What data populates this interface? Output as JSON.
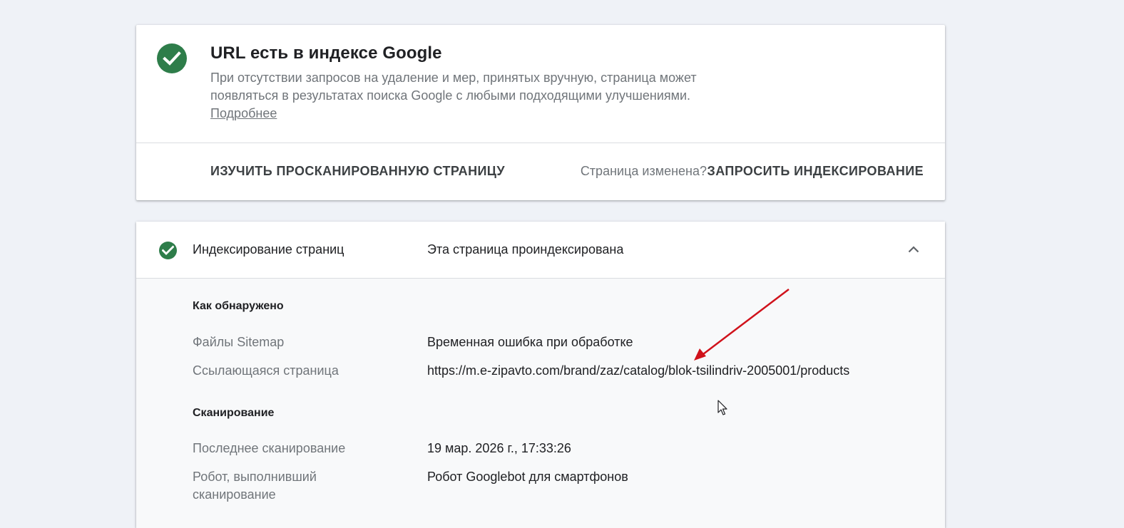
{
  "status": {
    "title": "URL есть в индексе Google",
    "description": "При отсутствии запросов на удаление и мер, принятых вручную, страница может появляться в результатах поиска Google с любыми подходящими улучшениями.",
    "learn_more": "Подробнее",
    "explore_button": "ИЗУЧИТЬ ПРОСКАНИРОВАННУЮ СТРАНИЦУ",
    "changed_question": "Страница изменена?",
    "request_button": "ЗАПРОСИТЬ ИНДЕКСИРОВАНИЕ"
  },
  "indexing": {
    "title": "Индексирование страниц",
    "status": "Эта страница проиндексирована",
    "discovery": {
      "heading": "Как обнаружено",
      "sitemaps_label": "Файлы Sitemap",
      "sitemaps_value": "Временная ошибка при обработке",
      "referring_label": "Ссылающаяся страница",
      "referring_value": "https://m.e-zipavto.com/brand/zaz/catalog/blok-tsilindriv-2005001/products"
    },
    "crawl": {
      "heading": "Сканирование",
      "last_crawl_label": "Последнее сканирование",
      "last_crawl_value": "19 мар. 2026 г., 17:33:26",
      "crawler_label": "Робот, выполнивший сканирование",
      "crawler_value": "Робот Googlebot для смартфонов"
    }
  },
  "colors": {
    "success": "#2e7d4a",
    "annotation_arrow": "#d0121b"
  }
}
